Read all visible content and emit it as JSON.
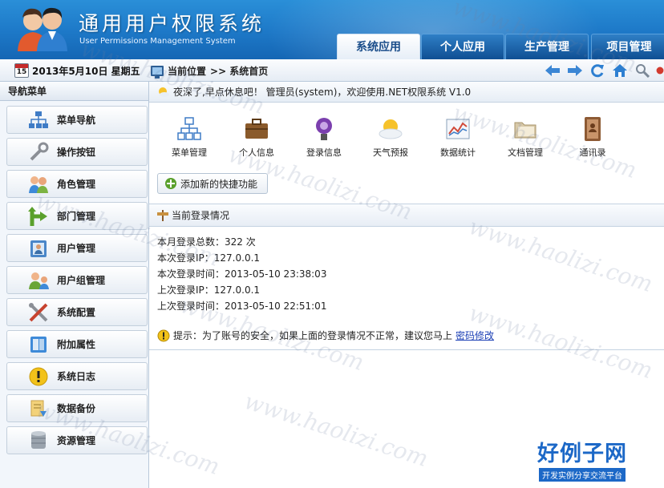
{
  "header": {
    "title": "通用用户权限系统",
    "subtitle": "User Permissions Management System",
    "tabs": [
      {
        "label": "系统应用",
        "active": true
      },
      {
        "label": "个人应用",
        "active": false
      },
      {
        "label": "生产管理",
        "active": false
      },
      {
        "label": "项目管理",
        "active": false
      }
    ]
  },
  "toolbar": {
    "date_day": "15",
    "date": "2013年5月10日 星期五",
    "location_label": "当前位置",
    "location_path": ">> 系统首页",
    "icons": [
      "back-arrow-icon",
      "forward-arrow-icon",
      "refresh-icon",
      "home-icon",
      "search-icon",
      "close-icon"
    ]
  },
  "sidebar": {
    "title": "导航菜单",
    "items": [
      {
        "label": "菜单导航",
        "icon": "sitemap-icon"
      },
      {
        "label": "操作按钮",
        "icon": "wrench-icon"
      },
      {
        "label": "角色管理",
        "icon": "users-icon"
      },
      {
        "label": "部门管理",
        "icon": "branch-arrow-icon"
      },
      {
        "label": "用户管理",
        "icon": "user-card-icon"
      },
      {
        "label": "用户组管理",
        "icon": "user-group-icon"
      },
      {
        "label": "系统配置",
        "icon": "tools-icon"
      },
      {
        "label": "附加属性",
        "icon": "panel-icon"
      },
      {
        "label": "系统日志",
        "icon": "warning-icon"
      },
      {
        "label": "数据备份",
        "icon": "backup-icon"
      },
      {
        "label": "资源管理",
        "icon": "database-icon"
      }
    ]
  },
  "welcome": "夜深了,早点休息吧！ 管理员(system)，欢迎使用.NET权限系统 V1.0",
  "quick_links": [
    {
      "label": "菜单管理",
      "icon": "sitemap-icon"
    },
    {
      "label": "个人信息",
      "icon": "briefcase-icon"
    },
    {
      "label": "登录信息",
      "icon": "login-icon"
    },
    {
      "label": "天气预报",
      "icon": "weather-icon"
    },
    {
      "label": "数据统计",
      "icon": "chart-icon"
    },
    {
      "label": "文档管理",
      "icon": "folder-icon"
    },
    {
      "label": "通讯录",
      "icon": "contacts-book-icon"
    }
  ],
  "add_quick_label": "添加新的快捷功能",
  "login_panel": {
    "title": "当前登录情况",
    "lines": [
      "本月登录总数：322 次",
      "本次登录IP：127.0.0.1",
      "本次登录时间：2013-05-10 23:38:03",
      "上次登录IP：127.0.0.1",
      "上次登录时间：2013-05-10 22:51:01"
    ],
    "tip_text": "提示：为了账号的安全，如果上面的登录情况不正常，建议您马上",
    "tip_link": "密码修改"
  },
  "watermark": "www.haolizi.com",
  "brand": {
    "name": "好例子网",
    "slogan": "开发实例分享交流平台"
  },
  "colors": {
    "header_blue": "#1d78c7",
    "link_blue": "#1b3fb5",
    "brand_blue": "#1c68c7"
  }
}
